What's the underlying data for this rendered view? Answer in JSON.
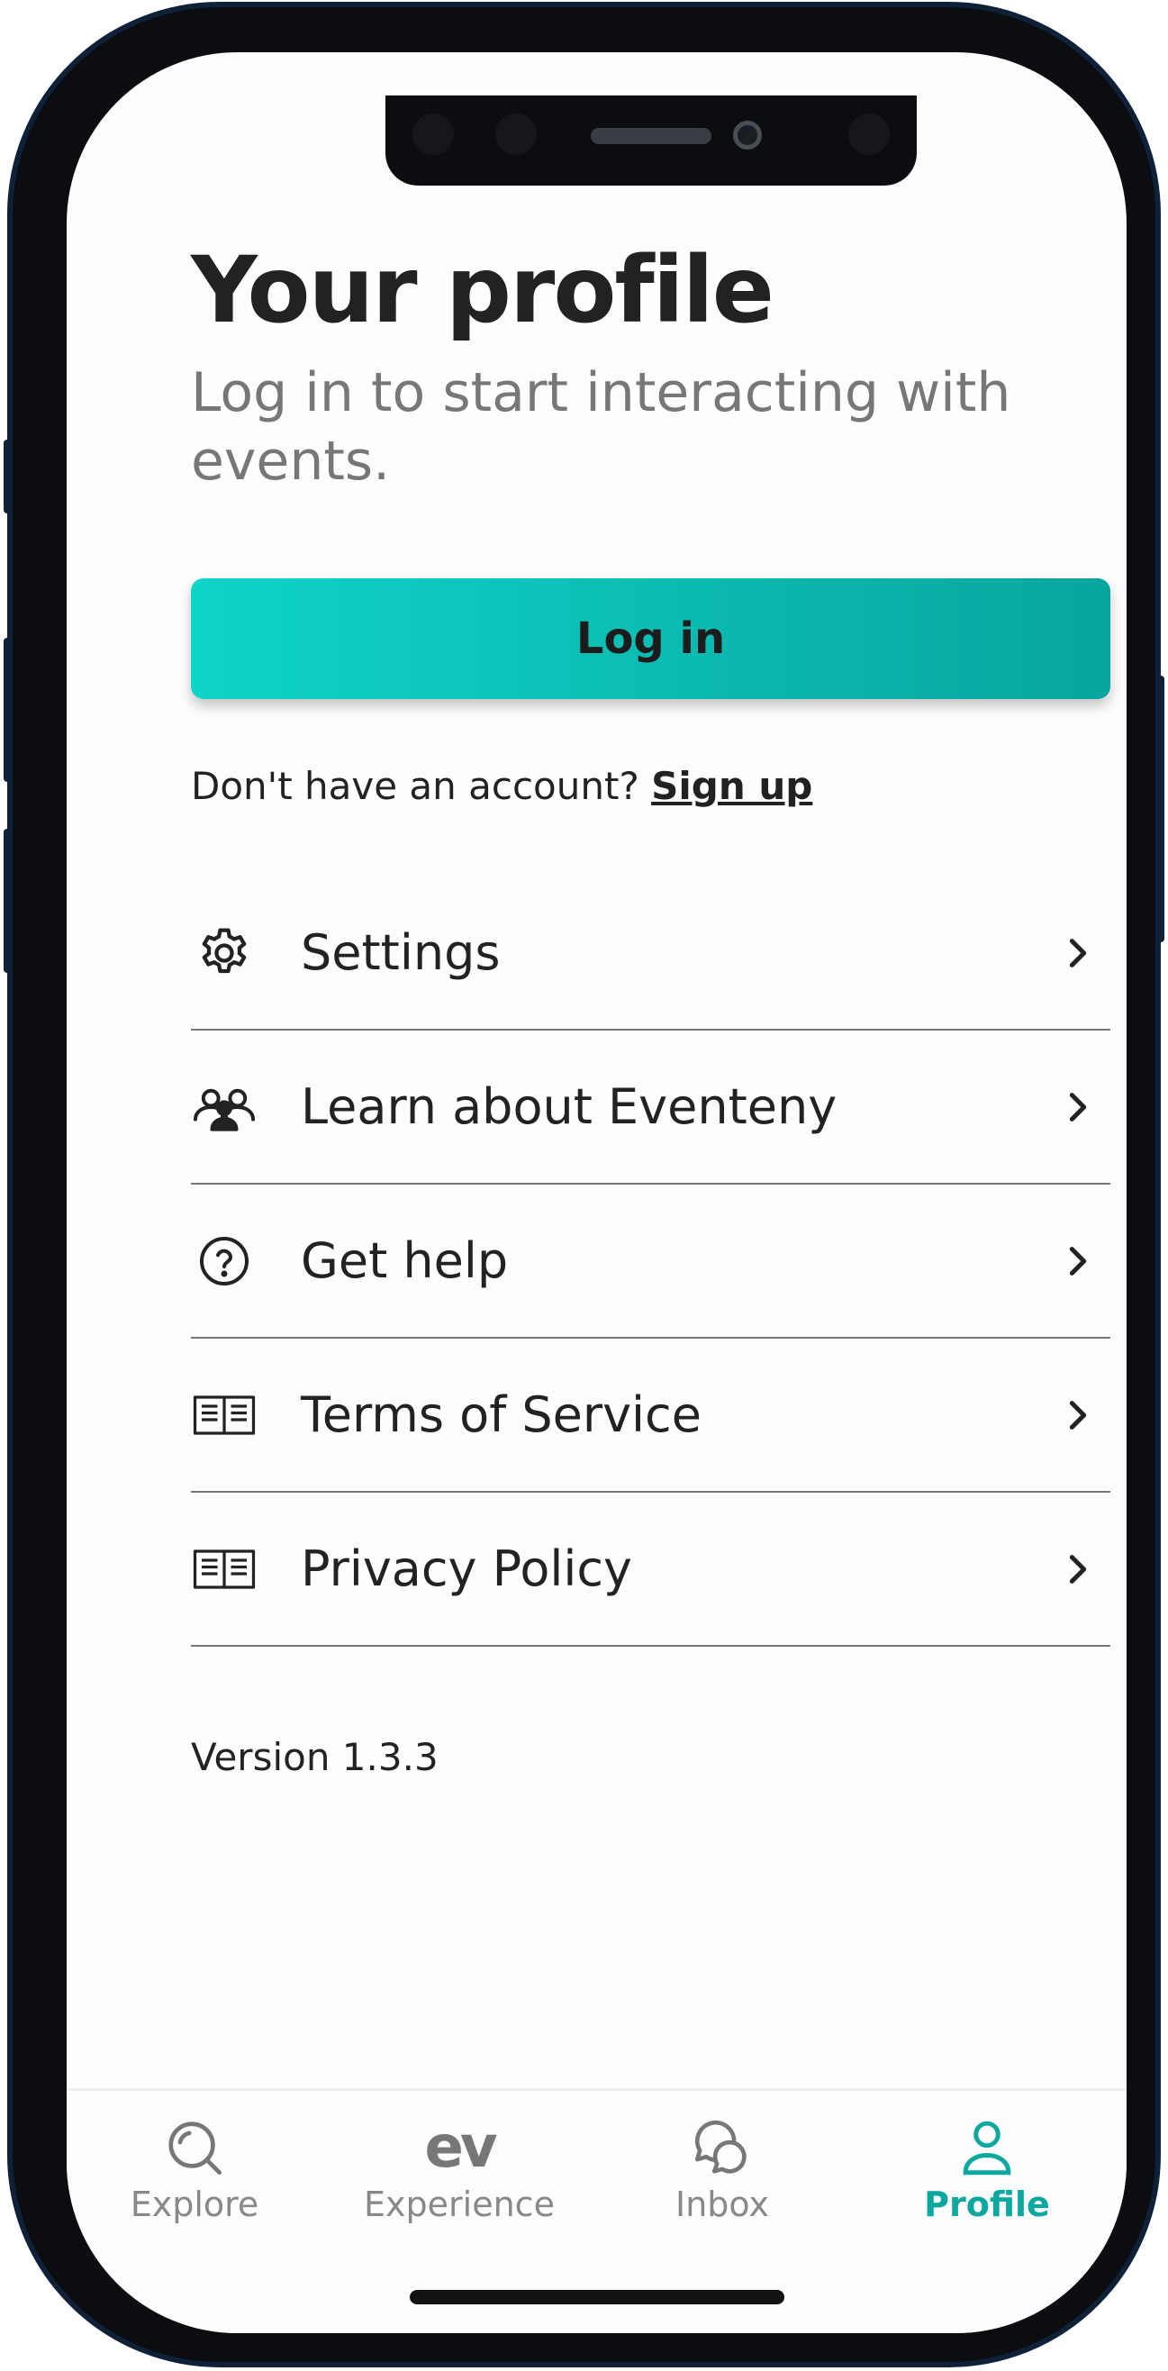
{
  "header": {
    "title": "Your profile",
    "subtitle": "Log in to start interacting with events."
  },
  "auth": {
    "login_label": "Log in",
    "signup_prompt": "Don't have an account?",
    "signup_label": "Sign up"
  },
  "menu": {
    "items": [
      {
        "label": "Settings",
        "icon": "gear-icon"
      },
      {
        "label": "Learn about Eventeny",
        "icon": "group-icon"
      },
      {
        "label": "Get help",
        "icon": "help-circle-icon"
      },
      {
        "label": "Terms of Service",
        "icon": "book-icon"
      },
      {
        "label": "Privacy Policy",
        "icon": "book-icon"
      }
    ]
  },
  "footer": {
    "version": "Version 1.3.3"
  },
  "tabbar": {
    "tabs": [
      {
        "label": "Explore",
        "icon": "search-icon",
        "active": false
      },
      {
        "label": "Experience",
        "icon": "ev-logo-icon",
        "logo_text": "ev",
        "active": false
      },
      {
        "label": "Inbox",
        "icon": "chat-bubbles-icon",
        "active": false
      },
      {
        "label": "Profile",
        "icon": "person-icon",
        "active": true
      }
    ]
  },
  "colors": {
    "accent": "#0aa89f",
    "button_gradient_start": "#0fd4c9",
    "button_gradient_end": "#08a59d",
    "text_primary": "#222222",
    "text_secondary": "#777777"
  }
}
